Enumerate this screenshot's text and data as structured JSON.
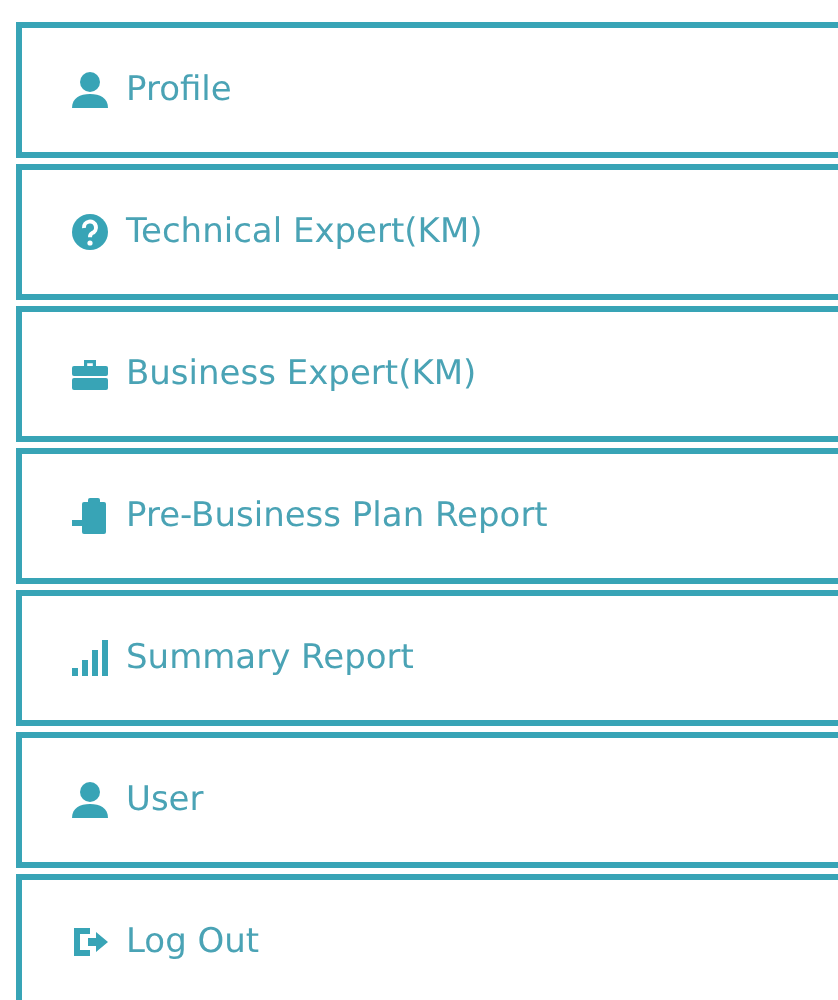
{
  "menu": [
    {
      "label": "Profile"
    },
    {
      "label": "Technical Expert(KM)"
    },
    {
      "label": "Business Expert(KM)"
    },
    {
      "label": "Pre-Business Plan Report"
    },
    {
      "label": "Summary Report"
    },
    {
      "label": "User"
    },
    {
      "label": "Log Out"
    }
  ]
}
